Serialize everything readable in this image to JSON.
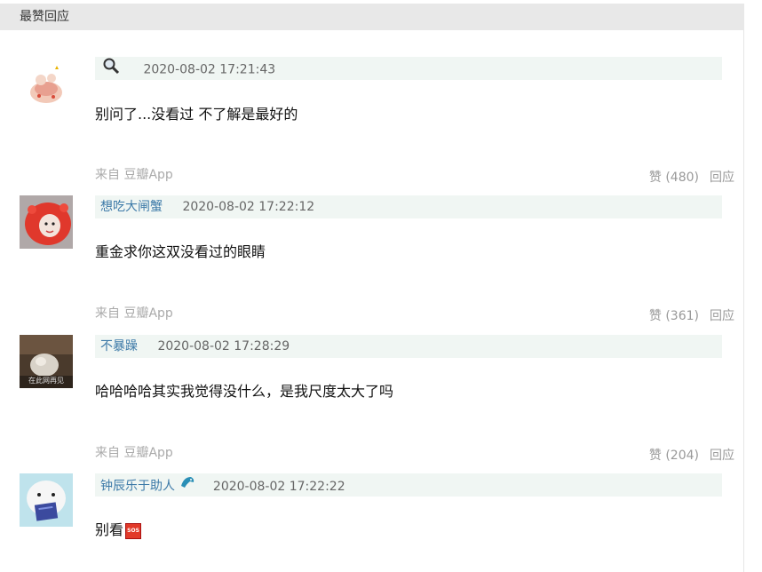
{
  "section": {
    "title": "最赞回应"
  },
  "comments": [
    {
      "author": "",
      "time": "2020-08-02 17:21:43",
      "content": "别问了...没看过 不了解是最好的",
      "source": "",
      "likes": "",
      "reply": ""
    },
    {
      "author": "想吃大闸蟹",
      "time": "2020-08-02 17:22:12",
      "content": "重金求你这双没看过的眼睛",
      "source": "来自 豆瓣App",
      "likes": "赞 (480)",
      "reply": "回应"
    },
    {
      "author": "不暴躁",
      "time": "2020-08-02 17:28:29",
      "content": "哈哈哈哈其实我觉得没什么，是我尺度太大了吗",
      "source": "来自 豆瓣App",
      "likes": "赞 (361)",
      "reply": "回应"
    },
    {
      "author": "钟辰乐于助人",
      "time": "2020-08-02 17:22:22",
      "content": "别看",
      "source": "来自 豆瓣App",
      "likes": "赞 (204)",
      "reply": "回应"
    }
  ],
  "avatar_texts": {
    "comment3": "在此网再见"
  },
  "emoji_texts": {
    "sos": "SOS"
  }
}
